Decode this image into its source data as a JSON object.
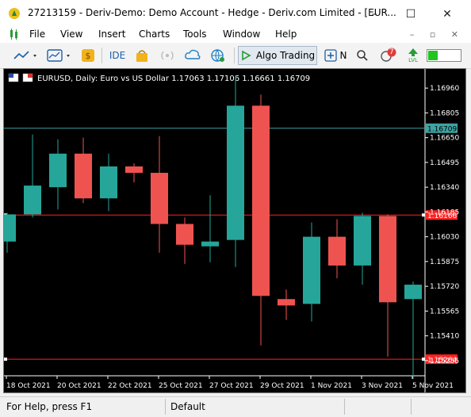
{
  "window": {
    "title": "27213159 - Deriv-Demo: Demo Account - Hedge - Deriv.com Limited - [EUR...",
    "minimize": "–",
    "maximize": "☐",
    "close": "✕"
  },
  "menu": {
    "items": [
      "File",
      "View",
      "Insert",
      "Charts",
      "Tools",
      "Window",
      "Help"
    ],
    "mdi_controls": "– ▫ ✕"
  },
  "toolbar": {
    "ide_label": "IDE",
    "algo_label": "Algo Trading",
    "new_order_label": "N",
    "notification_count": "7",
    "lvl_label": "LVL"
  },
  "colors": {
    "bull": "#26a69a",
    "bear": "#ef5350",
    "background": "#000000",
    "hline_red": "#ff2222",
    "hline_teal": "#3fa3a3",
    "axis_text": "#ffffff",
    "status_green": "#22c422"
  },
  "chart_data": {
    "type": "candlestick",
    "title": "EURUSD, Daily:  Euro vs US Dollar  1.17063 1.17106 1.16661 1.16709",
    "x_labels": [
      "18 Oct 2021",
      "20 Oct 2021",
      "22 Oct 2021",
      "25 Oct 2021",
      "27 Oct 2021",
      "29 Oct 2021",
      "1 Nov 2021",
      "3 Nov 2021",
      "5 Nov 2021"
    ],
    "y_ticks": [
      "1.16960",
      "1.16805",
      "1.16650",
      "1.16495",
      "1.16340",
      "1.16185",
      "1.16030",
      "1.15875",
      "1.15720",
      "1.15565",
      "1.15410",
      "1.15255"
    ],
    "ylim": [
      1.1518,
      1.1704
    ],
    "candles": [
      {
        "date": "15 Oct 2021",
        "open": 1.16,
        "high": 1.1618,
        "low": 1.1593,
        "close": 1.1617
      },
      {
        "date": "18 Oct 2021",
        "open": 1.1617,
        "high": 1.1667,
        "low": 1.1615,
        "close": 1.1635
      },
      {
        "date": "19 Oct 2021",
        "open": 1.1634,
        "high": 1.1664,
        "low": 1.162,
        "close": 1.1655
      },
      {
        "date": "20 Oct 2021",
        "open": 1.1655,
        "high": 1.1665,
        "low": 1.1624,
        "close": 1.1627
      },
      {
        "date": "21 Oct 2021",
        "open": 1.1627,
        "high": 1.1655,
        "low": 1.1619,
        "close": 1.1647
      },
      {
        "date": "22 Oct 2021",
        "open": 1.1647,
        "high": 1.1649,
        "low": 1.1637,
        "close": 1.1643
      },
      {
        "date": "25 Oct 2021",
        "open": 1.1643,
        "high": 1.1666,
        "low": 1.1593,
        "close": 1.1611
      },
      {
        "date": "26 Oct 2021",
        "open": 1.1611,
        "high": 1.1615,
        "low": 1.1586,
        "close": 1.1598
      },
      {
        "date": "27 Oct 2021",
        "open": 1.1597,
        "high": 1.1629,
        "low": 1.1587,
        "close": 1.16
      },
      {
        "date": "28 Oct 2021",
        "open": 1.1601,
        "high": 1.1704,
        "low": 1.1584,
        "close": 1.1685
      },
      {
        "date": "29 Oct 2021",
        "open": 1.1685,
        "high": 1.1692,
        "low": 1.1535,
        "close": 1.1566
      },
      {
        "date": "1 Nov 2021",
        "open": 1.1564,
        "high": 1.157,
        "low": 1.1551,
        "close": 1.156
      },
      {
        "date": "2 Nov 2021",
        "open": 1.1561,
        "high": 1.1612,
        "low": 1.155,
        "close": 1.1603
      },
      {
        "date": "3 Nov 2021",
        "open": 1.1603,
        "high": 1.1614,
        "low": 1.1577,
        "close": 1.1585
      },
      {
        "date": "4 Nov 2021",
        "open": 1.1585,
        "high": 1.1618,
        "low": 1.1573,
        "close": 1.1616
      },
      {
        "date": "5 Nov 2021",
        "open": 1.1616,
        "high": 1.1617,
        "low": 1.1528,
        "close": 1.1562
      },
      {
        "date": "8 Nov 2021",
        "open": 1.1564,
        "high": 1.1575,
        "low": 1.1514,
        "close": 1.1573
      }
    ],
    "hlines": [
      {
        "value": 1.16709,
        "label": "1.16709",
        "color": "#3fa3a3"
      },
      {
        "value": 1.16166,
        "label": "1.16166",
        "color": "#ff2222"
      },
      {
        "value": 1.15264,
        "label": "1.15264",
        "color": "#ff2222"
      }
    ],
    "grid": false
  },
  "status": {
    "help": "For Help, press F1",
    "profile": "Default"
  }
}
